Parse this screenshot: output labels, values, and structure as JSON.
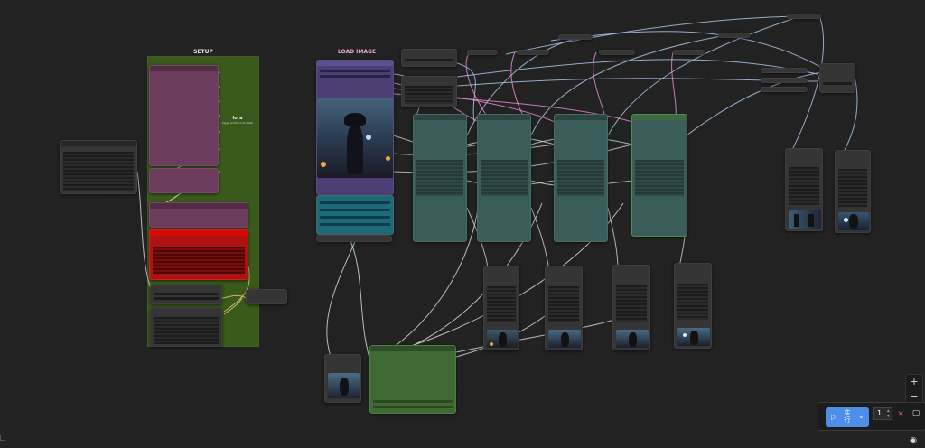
{
  "groups": {
    "setup_title": "SETUP",
    "load_image_title": "LOAD IMAGE"
  },
  "note": {
    "title": "lora",
    "subtitle": "trigger words in lora loader"
  },
  "toolbar": {
    "run_label": "实行",
    "run_icon": "play-icon",
    "dropdown_icon": "chevron-down-icon",
    "queue_count": "1",
    "cancel_icon": "close-icon",
    "toggle_icon": "square-icon",
    "zoom_in": "+",
    "zoom_out": "−",
    "eye_icon": "eye-icon"
  },
  "colors": {
    "canvas": "#222222",
    "setup_group": "#3a5a1c",
    "pink_node": "#6b3c5c",
    "red_node": "#b01212",
    "teal_node": "#3a5d5a",
    "purple_node": "#4d3e76",
    "run_button": "#4c8ee8"
  }
}
